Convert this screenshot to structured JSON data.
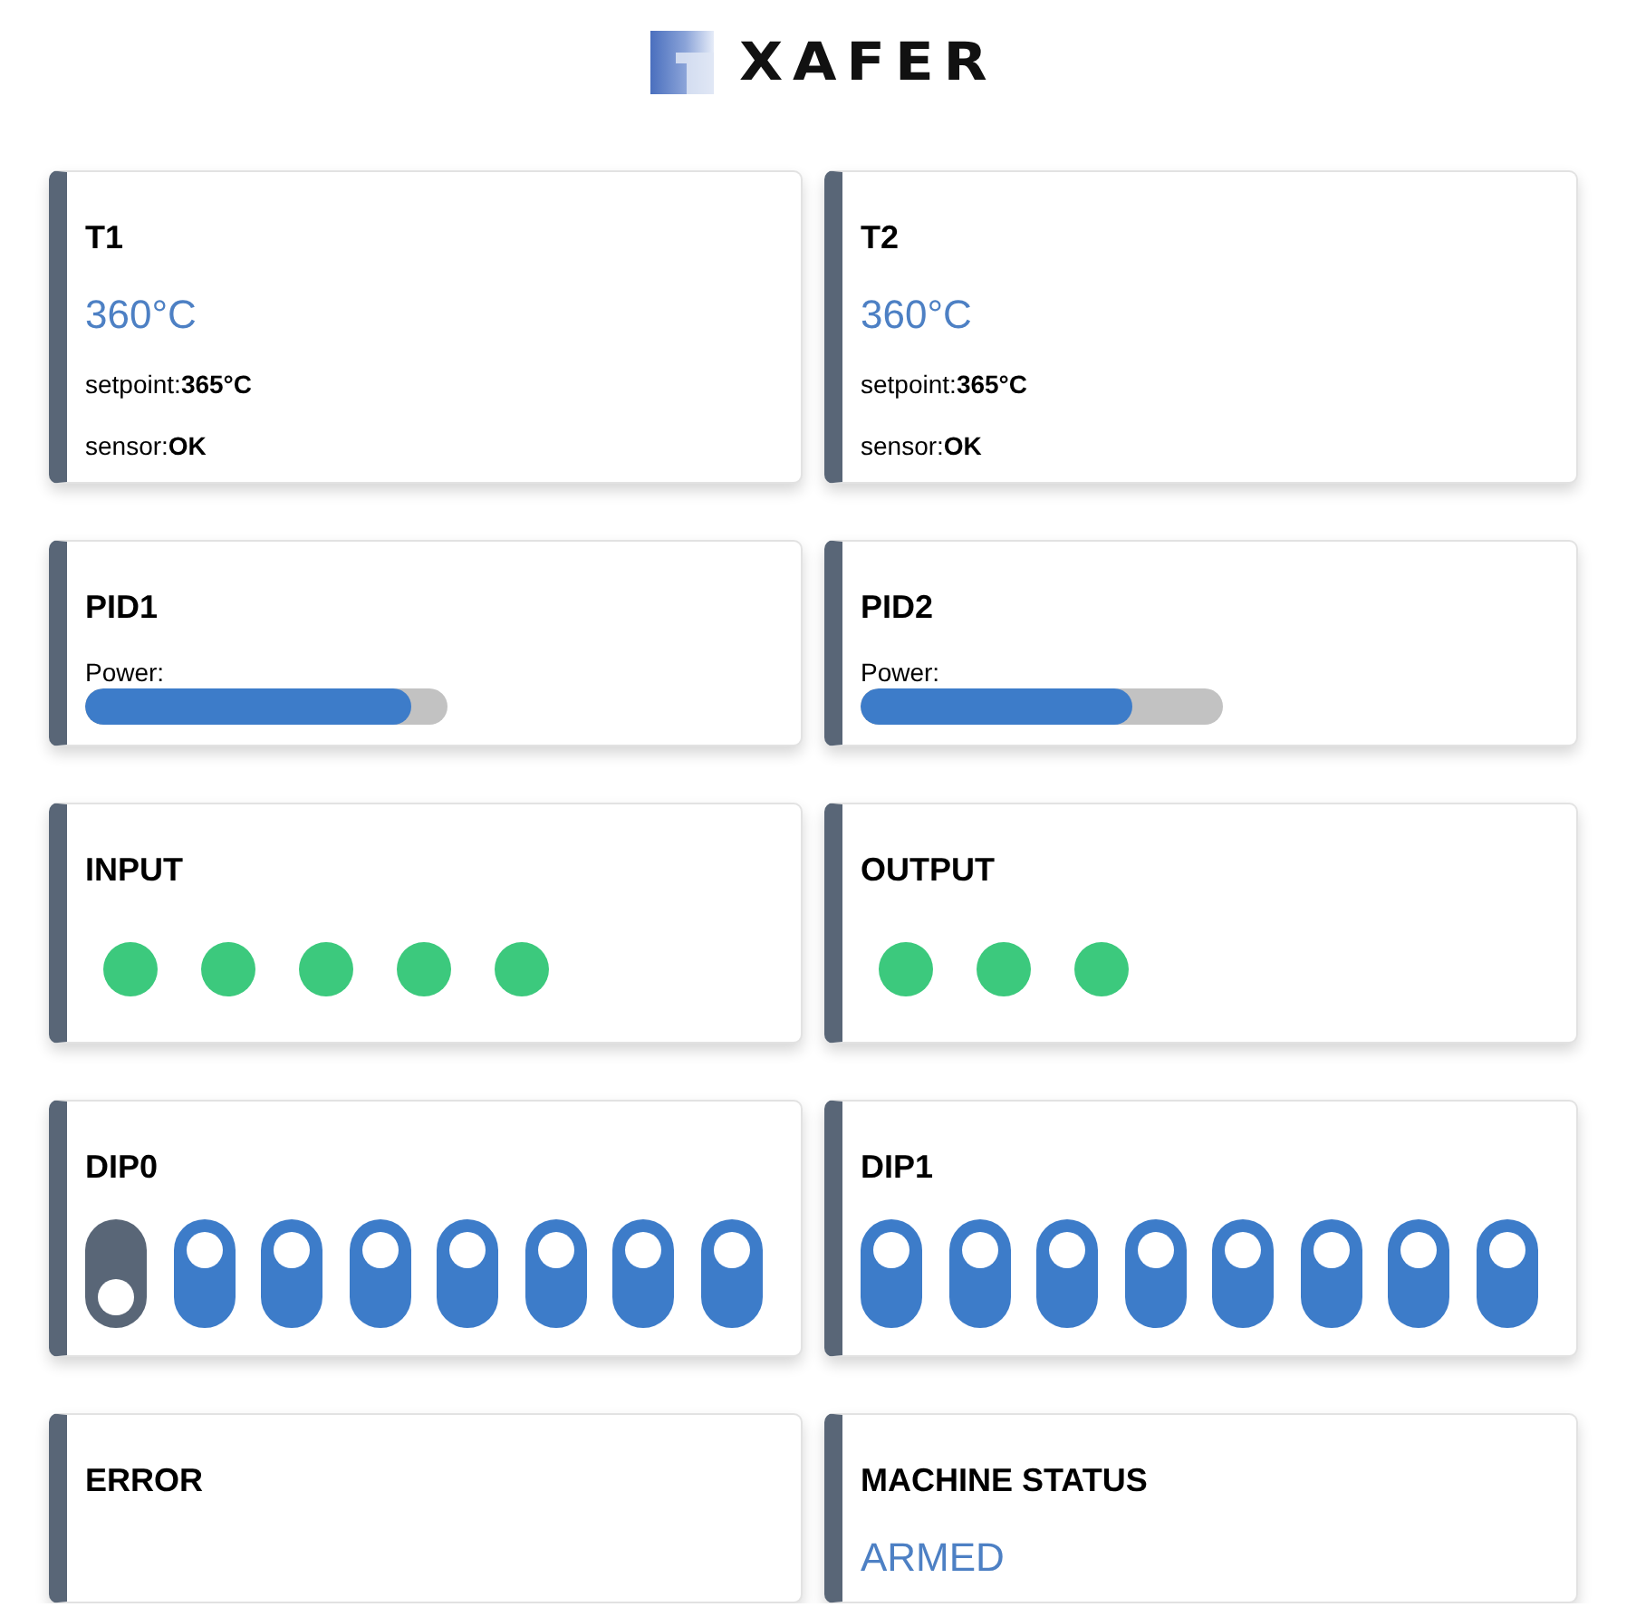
{
  "header": {
    "logo_text": "XAFER"
  },
  "cards": [
    {
      "kind": "temperature",
      "title": "T1",
      "value": "360°C",
      "setpoint": "setpoint:**365°C**",
      "sensor": "sensor:**OK**"
    },
    {
      "kind": "temperature",
      "title": "T2",
      "value": "360°C",
      "setpoint": "setpoint:**365°C**",
      "sensor": "sensor:**OK**"
    },
    {
      "kind": "pid",
      "title": "PID1",
      "label": "Power:",
      "level": 0.9
    },
    {
      "kind": "pid",
      "title": "PID2",
      "label": "Power:",
      "level": 0.75
    },
    {
      "kind": "leds",
      "title": "INPUT",
      "leds": [
        {
          "on": true
        },
        {
          "on": true
        },
        {
          "on": true
        },
        {
          "on": true
        },
        {
          "on": true
        }
      ]
    },
    {
      "kind": "leds",
      "title": "OUTPUT",
      "leds": [
        {
          "on": true
        },
        {
          "on": true
        },
        {
          "on": true
        }
      ]
    },
    {
      "kind": "dip",
      "title": "DIP0",
      "switches": [
        {
          "on": false
        },
        {
          "on": true
        },
        {
          "on": true
        },
        {
          "on": true
        },
        {
          "on": true
        },
        {
          "on": true
        },
        {
          "on": true
        },
        {
          "on": true
        }
      ]
    },
    {
      "kind": "dip",
      "title": "DIP1",
      "switches": [
        {
          "on": true
        },
        {
          "on": true
        },
        {
          "on": true
        },
        {
          "on": true
        },
        {
          "on": true
        },
        {
          "on": true
        },
        {
          "on": true
        },
        {
          "on": true
        }
      ]
    },
    {
      "kind": "status",
      "title": "ERROR"
    },
    {
      "kind": "status",
      "title": "MACHINE STATUS",
      "value": "ARMED"
    }
  ]
}
